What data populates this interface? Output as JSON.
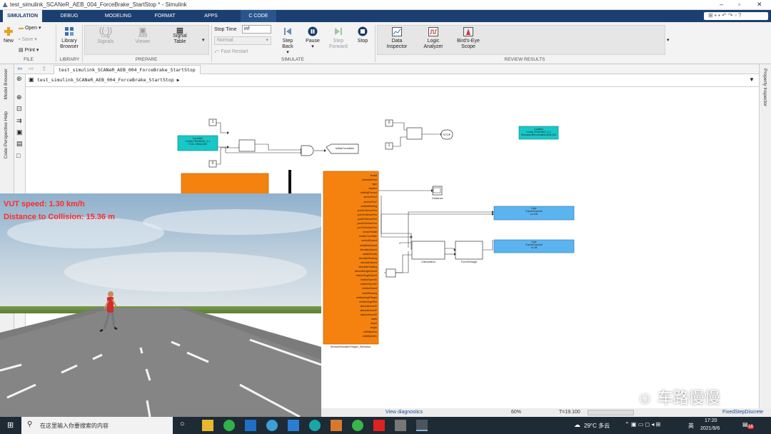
{
  "window": {
    "title": "test_simulink_SCANeR_AEB_004_ForceBrake_StartStop * - Simulink"
  },
  "tabs": [
    {
      "label": "SIMULATION",
      "active": true
    },
    {
      "label": "DEBUG"
    },
    {
      "label": "MODELING"
    },
    {
      "label": "FORMAT"
    },
    {
      "label": "APPS"
    },
    {
      "label": "C CODE"
    }
  ],
  "ribbon": {
    "file": {
      "new": "New",
      "open": "Open",
      "save": "Save",
      "print": "Print",
      "group": "FILE"
    },
    "library": {
      "browser": "Library Browser",
      "group": "LIBRARY"
    },
    "prepare": {
      "log_signals": "Log Signals",
      "add_viewer": "Add Viewer",
      "signal_table": "Signal Table",
      "group": "PREPARE"
    },
    "simulate": {
      "stop_time_label": "Stop Time",
      "stop_time_value": "inf",
      "mode": "Normal",
      "fast_restart": "Fast Restart",
      "step_back": "Step Back",
      "pause": "Pause",
      "step_forward": "Step Forward",
      "stop": "Stop",
      "group": "SIMULATE"
    },
    "review": {
      "data_inspector": "Data Inspector",
      "logic_analyzer": "Logic Analyzer",
      "birds_eye": "Bird's-Eye Scope",
      "group": "REVIEW RESULTS"
    }
  },
  "nav": {
    "tab": "test_simulink_SCANeR_AEB_004_ForceBrake_StartStop",
    "breadcrumb": "test_simulink_SCANeR_AEB_004_ForceBrake_StartStop"
  },
  "left_panel": {
    "model_browser": "Model Browser",
    "perspective": "Code Perspective Help"
  },
  "right_panel": {
    "property_inspector": "Property Inspector"
  },
  "diagram": {
    "const1": "1",
    "const0": "0",
    "const0b": "0",
    "const1b": "1",
    "init_block": "Condition\nConfig TRAINING_1-1\nFULL SIMULINK",
    "location": "Location\nConfig TRAINING_1-1\nScenario:test-simulink-AEB-004",
    "initial_condition": "InitialCondition",
    "stop": "STOP",
    "distance": "Distance",
    "calculation": "Calculation",
    "force_design": "ForceDesign",
    "sensor_block": "SensorMovableTarget_Stimulus",
    "user1": "User\nExportChannel\nno 100",
    "user2": "User\nExportChannel\nno 98",
    "sensor_ports": [
      "isvalid",
      "detectedPoint",
      "type",
      "targetId",
      "visibilityPercent",
      "anchorPosX",
      "anchorPosY",
      "relativeBearing",
      "posXInSensorFrm",
      "posYInSensorFrm",
      "posZInSensorFrm",
      "posXInVehicleFrm",
      "posYInVehicleFrm",
      "sensorRadial",
      "relativeTurnRate",
      "azimuthSpeed",
      "radialAbsSpeed",
      "elevationSpeed",
      "radialVelocity",
      "elevationBearing",
      "absoluteSpeed",
      "absoluteHeading",
      "absoluteAngleSpeed",
      "relativeAngleSpeed",
      "relativeSpeedX",
      "relativeSpeedY",
      "relativeSpeed",
      "roadXBearing",
      "relativeAngleTarget",
      "relativeAngleRel",
      "absoluteAccelX",
      "absoluteAccelY",
      "absoluteAccelZ",
      "width",
      "height",
      "length",
      "visibilityArea",
      "visibilityIndex"
    ]
  },
  "overlay": {
    "speed": "VUT speed: 1.30 km/h",
    "distance": "Distance to Collision: 15.36 m"
  },
  "status": {
    "view_diagnostics": "View diagnostics",
    "zoom": "60%",
    "time": "T=19.100",
    "solver": "FixedStepDiscrete"
  },
  "watermark": "车路慢慢",
  "taskbar": {
    "search": "在这里输入你要搜索的内容",
    "weather": "29°C 多云",
    "lang": "英",
    "time": "17:20",
    "date": "2021/9/6",
    "badge": "18"
  }
}
